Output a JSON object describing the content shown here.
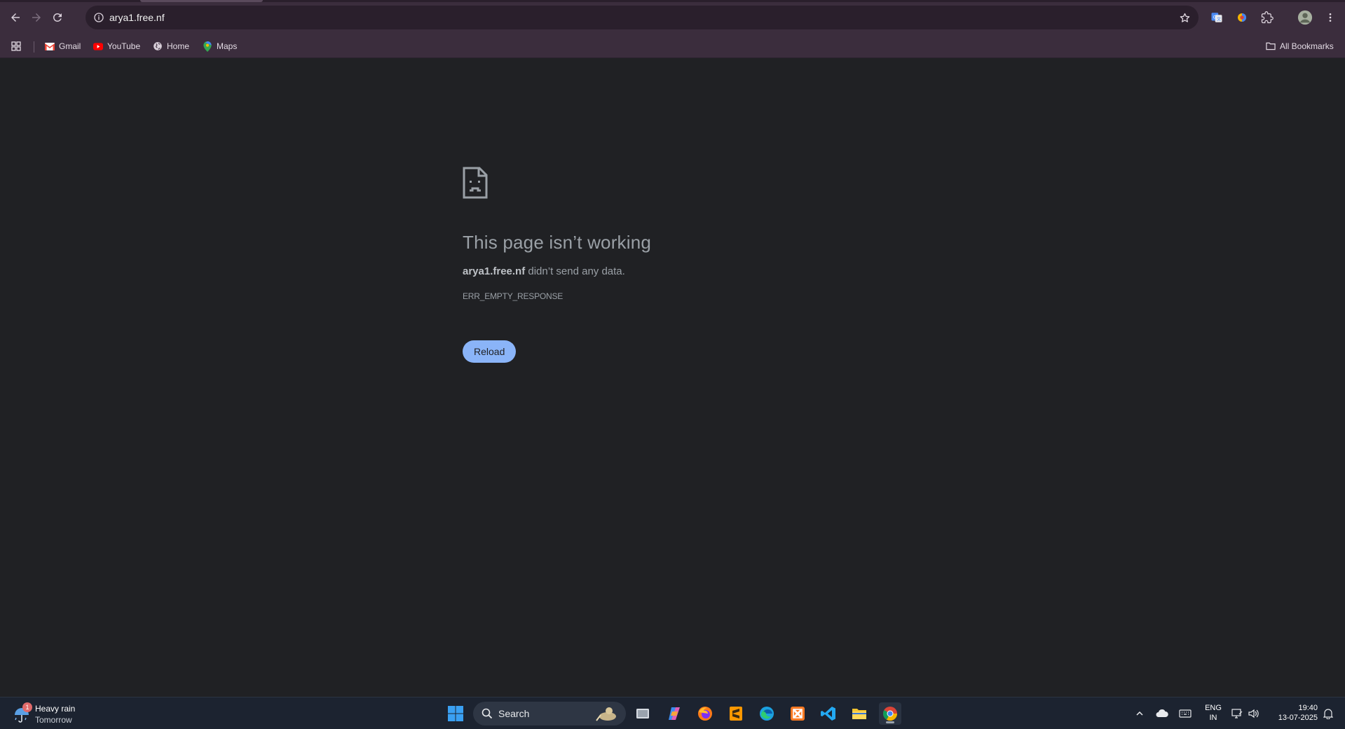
{
  "browser": {
    "url": "arya1.free.nf",
    "bookmarks": [
      {
        "label": "Gmail",
        "icon": "gmail-icon"
      },
      {
        "label": "YouTube",
        "icon": "youtube-icon"
      },
      {
        "label": "Home",
        "icon": "globe-icon"
      },
      {
        "label": "Maps",
        "icon": "maps-icon"
      }
    ],
    "all_bookmarks_label": "All Bookmarks",
    "colors": {
      "chrome_bg": "#3b2d3d",
      "omnibox_bg": "#2a1f2c",
      "page_bg": "#202124",
      "accent": "#8ab4f8"
    }
  },
  "error_page": {
    "title": "This page isn’t working",
    "host": "arya1.free.nf",
    "desc_rest": " didn’t send any data.",
    "code": "ERR_EMPTY_RESPONSE",
    "reload_label": "Reload"
  },
  "taskbar": {
    "weather": {
      "condition": "Heavy rain",
      "when": "Tomorrow",
      "badge": "1"
    },
    "search_placeholder": "Search",
    "apps": [
      "windows-start",
      "task-view",
      "copilot",
      "firefox",
      "sublime-text",
      "edge",
      "xampp",
      "vscode",
      "file-explorer",
      "chrome"
    ],
    "lang_line1": "ENG",
    "lang_line2": "IN",
    "time": "19:40",
    "date": "13-07-2025"
  }
}
